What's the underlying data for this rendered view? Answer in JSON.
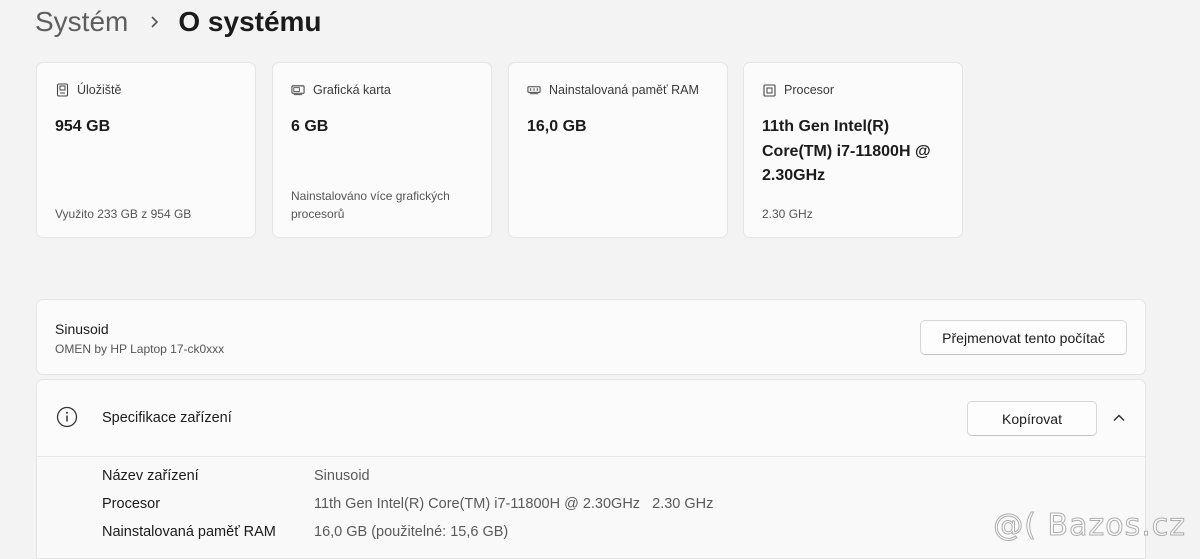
{
  "breadcrumb": {
    "parent": "Systém",
    "current": "O systému"
  },
  "cards": [
    {
      "icon": "storage-icon",
      "label": "Úložiště",
      "value": "954 GB",
      "sub": "Využito 233 GB z 954 GB"
    },
    {
      "icon": "graphics-card-icon",
      "label": "Grafická karta",
      "value": "6 GB",
      "sub": "Nainstalováno více grafických procesorů"
    },
    {
      "icon": "ram-icon",
      "label": "Nainstalovaná paměť RAM",
      "value": "16,0 GB",
      "sub": ""
    },
    {
      "icon": "processor-icon",
      "label": "Procesor",
      "value": "11th Gen Intel(R) Core(TM) i7-11800H @ 2.30GHz",
      "sub": "2.30 GHz"
    }
  ],
  "device": {
    "name": "Sinusoid",
    "model": "OMEN by HP Laptop 17-ck0xxx",
    "rename_label": "Přejmenovat tento počítač"
  },
  "spec": {
    "title": "Specifikace zařízení",
    "copy_label": "Kopírovat",
    "rows": [
      {
        "key": "Název zařízení",
        "value": "Sinusoid"
      },
      {
        "key": "Procesor",
        "value": "11th Gen Intel(R) Core(TM) i7-11800H @ 2.30GHz   2.30 GHz"
      },
      {
        "key": "Nainstalovaná paměť RAM",
        "value": "16,0 GB (použitelné: 15,6 GB)"
      }
    ]
  },
  "watermark": "@( Bazos.cz"
}
